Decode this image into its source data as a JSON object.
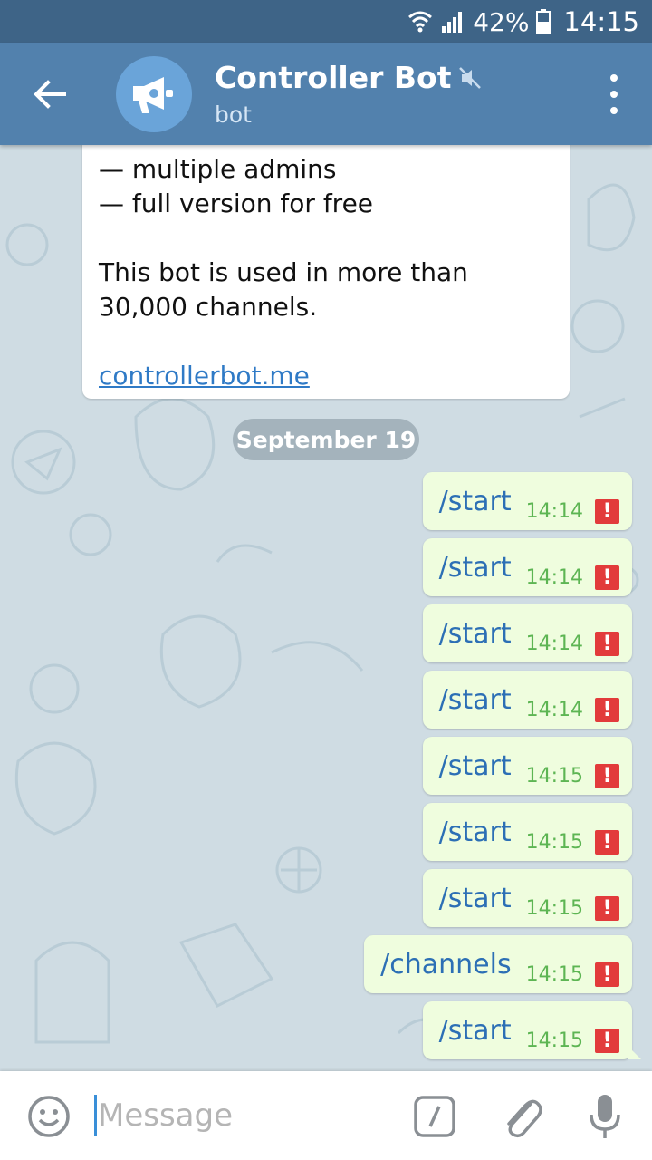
{
  "status_bar": {
    "battery": "42%",
    "time": "14:15"
  },
  "header": {
    "title": "Controller Bot",
    "subtitle": "bot"
  },
  "bot_message": {
    "lines": [
      "— multiple admins",
      "— full version for free",
      "",
      "This bot is used in more than",
      "30,000 channels.",
      ""
    ],
    "link": "controllerbot.me"
  },
  "date_separator": "September 19",
  "outgoing_messages": [
    {
      "text": "/start",
      "time": "14:14",
      "status": "error"
    },
    {
      "text": "/start",
      "time": "14:14",
      "status": "error"
    },
    {
      "text": "/start",
      "time": "14:14",
      "status": "error"
    },
    {
      "text": "/start",
      "time": "14:14",
      "status": "error"
    },
    {
      "text": "/start",
      "time": "14:15",
      "status": "error"
    },
    {
      "text": "/start",
      "time": "14:15",
      "status": "error"
    },
    {
      "text": "/start",
      "time": "14:15",
      "status": "error"
    },
    {
      "text": "/channels",
      "time": "14:15",
      "status": "error"
    },
    {
      "text": "/start",
      "time": "14:15",
      "status": "error"
    }
  ],
  "error_glyph": "!",
  "input": {
    "placeholder": "Message",
    "value": ""
  },
  "icons": {
    "back": "arrow-left-icon",
    "avatar": "megaphone-icon",
    "muted": "mute-icon",
    "menu": "more-vert-icon",
    "emoji": "smiley-icon",
    "command": "slash-command-icon",
    "attach": "paperclip-icon",
    "mic": "microphone-icon"
  },
  "colors": {
    "header": "#5281ad",
    "statusbar": "#3e6487",
    "outgoing_bubble": "#effdde",
    "outgoing_text": "#2c6fb5",
    "time_text": "#5db553",
    "error": "#e23b3b",
    "link": "#2f7ac6"
  }
}
